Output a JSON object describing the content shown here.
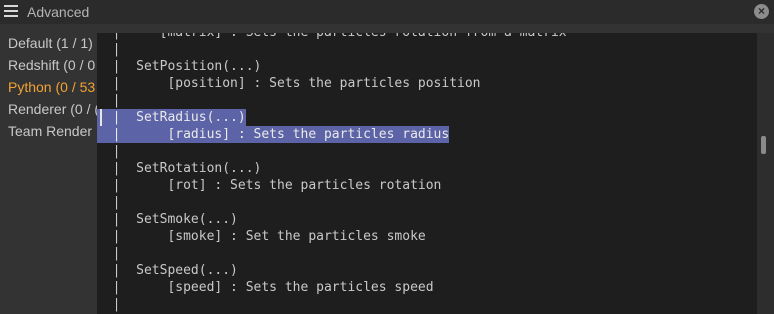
{
  "titlebar": {
    "title": "Advanced"
  },
  "sidebar": {
    "items": [
      {
        "label": "Default (1 / 1)"
      },
      {
        "label": "Redshift (0 / 0"
      },
      {
        "label": "Python (0 / 53"
      },
      {
        "label": "Renderer (0 / ("
      },
      {
        "label": "Team Render"
      }
    ]
  },
  "editor": {
    "lines": [
      "  |     [matrix] : Sets the particles rotation from a matrix",
      "  |",
      "  |  SetPosition(...)",
      "  |      [position] : Sets the particles position",
      "  |",
      "  |  SetRadius(...)",
      "  |      [radius] : Sets the particles radius",
      "  |",
      "  |  SetRotation(...)",
      "  |      [rot] : Sets the particles rotation",
      "  |",
      "  |  SetSmoke(...)",
      "  |      [smoke] : Set the particles smoke",
      "  |",
      "  |  SetSpeed(...)",
      "  |      [speed] : Sets the particles speed",
      "  |"
    ]
  }
}
